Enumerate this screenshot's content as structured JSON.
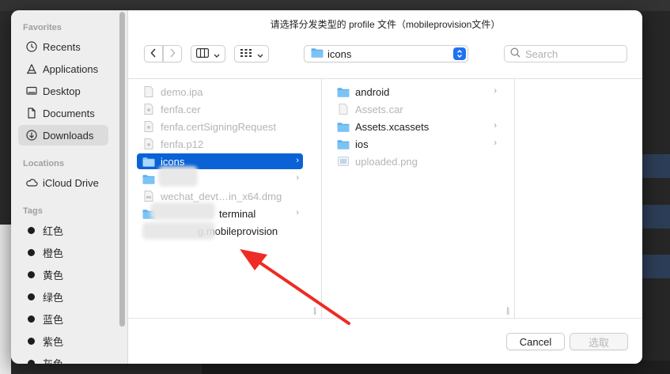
{
  "dialog": {
    "title": "请选择分发类型的 profile 文件（mobileprovision文件）"
  },
  "sidebar": {
    "favorites_label": "Favorites",
    "favorites": [
      {
        "label": "Recents",
        "icon": "clock-icon"
      },
      {
        "label": "Applications",
        "icon": "applications-icon"
      },
      {
        "label": "Desktop",
        "icon": "desktop-icon"
      },
      {
        "label": "Documents",
        "icon": "document-icon"
      },
      {
        "label": "Downloads",
        "icon": "downloads-icon",
        "selected": true
      }
    ],
    "locations_label": "Locations",
    "locations": [
      {
        "label": "iCloud Drive",
        "icon": "cloud-icon"
      }
    ],
    "tags_label": "Tags",
    "tags": [
      "红色",
      "橙色",
      "黄色",
      "绿色",
      "蓝色",
      "紫色",
      "灰色"
    ]
  },
  "toolbar": {
    "back_icon": "chevron-left-icon",
    "forward_icon": "chevron-right-icon",
    "location": "icons",
    "search_placeholder": "Search"
  },
  "column1": [
    {
      "name": "demo.ipa",
      "dim": true,
      "icon": "file-icon"
    },
    {
      "name": "fenfa.cer",
      "dim": true,
      "icon": "certificate-icon"
    },
    {
      "name": "fenfa.certSigningRequest",
      "dim": true,
      "icon": "certificate-icon"
    },
    {
      "name": "fenfa.p12",
      "dim": true,
      "icon": "certificate-icon"
    },
    {
      "name": "icons",
      "folder": true,
      "selected": true,
      "icon": "folder-icon"
    },
    {
      "name": "",
      "folder": true,
      "icon": "folder-icon",
      "redacted": true
    },
    {
      "name": "wechat_devt…in_x64.dmg",
      "dim": true,
      "icon": "disk-image-icon"
    },
    {
      "name": "terminal",
      "folder": true,
      "icon": "folder-icon",
      "redacted": true
    },
    {
      "name": "g.mobileprovision",
      "icon": "file-icon",
      "redacted": true
    }
  ],
  "column2": [
    {
      "name": "android",
      "folder": true,
      "icon": "folder-icon"
    },
    {
      "name": "Assets.car",
      "dim": true,
      "icon": "file-icon"
    },
    {
      "name": "Assets.xcassets",
      "folder": true,
      "icon": "folder-icon"
    },
    {
      "name": "ios",
      "folder": true,
      "icon": "folder-icon"
    },
    {
      "name": "uploaded.png",
      "dim": true,
      "icon": "image-file-icon"
    }
  ],
  "footer": {
    "cancel_label": "Cancel",
    "choose_label": "选取"
  },
  "colors": {
    "accent": "#0a62d6",
    "folder": "#5ab0ef",
    "annotation": "#ee2b24"
  }
}
